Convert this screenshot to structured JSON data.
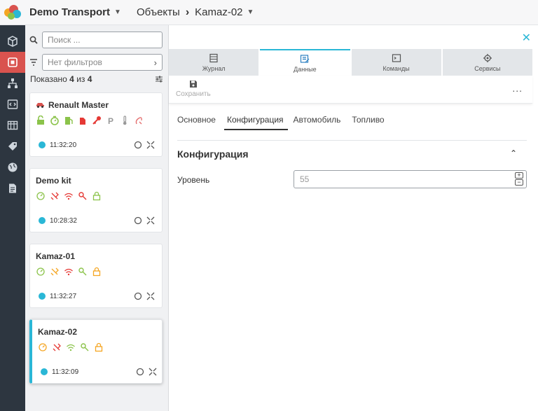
{
  "app": {
    "title": "Demo Transport"
  },
  "breadcrumb": {
    "section": "Объекты",
    "current": "Kamaz-02"
  },
  "nav": [
    "cube-icon",
    "objects-icon",
    "tree-icon",
    "code-icon",
    "table-icon",
    "tag-icon",
    "globe-icon",
    "doc-icon"
  ],
  "list": {
    "search_placeholder": "Поиск ...",
    "filter_placeholder": "Нет фильтров",
    "shown_prefix": "Показано",
    "shown_count": "4",
    "shown_mid": "из",
    "shown_total": "4",
    "cards": [
      {
        "title": "Renault Master",
        "time": "11:32:20"
      },
      {
        "title": "Demo kit",
        "time": "10:28:32"
      },
      {
        "title": "Kamaz-01",
        "time": "11:32:27"
      },
      {
        "title": "Kamaz-02",
        "time": "11:32:09"
      }
    ]
  },
  "tabs": [
    {
      "label": "Журнал",
      "icon": "journal-icon"
    },
    {
      "label": "Данные",
      "icon": "data-icon"
    },
    {
      "label": "Команды",
      "icon": "terminal-icon"
    },
    {
      "label": "Сервисы",
      "icon": "services-icon"
    }
  ],
  "toolbar": {
    "save_label": "Сохранить",
    "more": "..."
  },
  "subtabs": [
    "Основное",
    "Конфигурация",
    "Автомобиль",
    "Топливо"
  ],
  "section": {
    "title": "Конфигурация"
  },
  "field": {
    "label": "Уровень",
    "value": "55"
  },
  "colors": {
    "accent": "#2ab7d6",
    "active_nav": "#d9534f",
    "rail": "#2d3640",
    "green": "#8bc34a",
    "red": "#e53935",
    "orange": "#f5a623"
  }
}
